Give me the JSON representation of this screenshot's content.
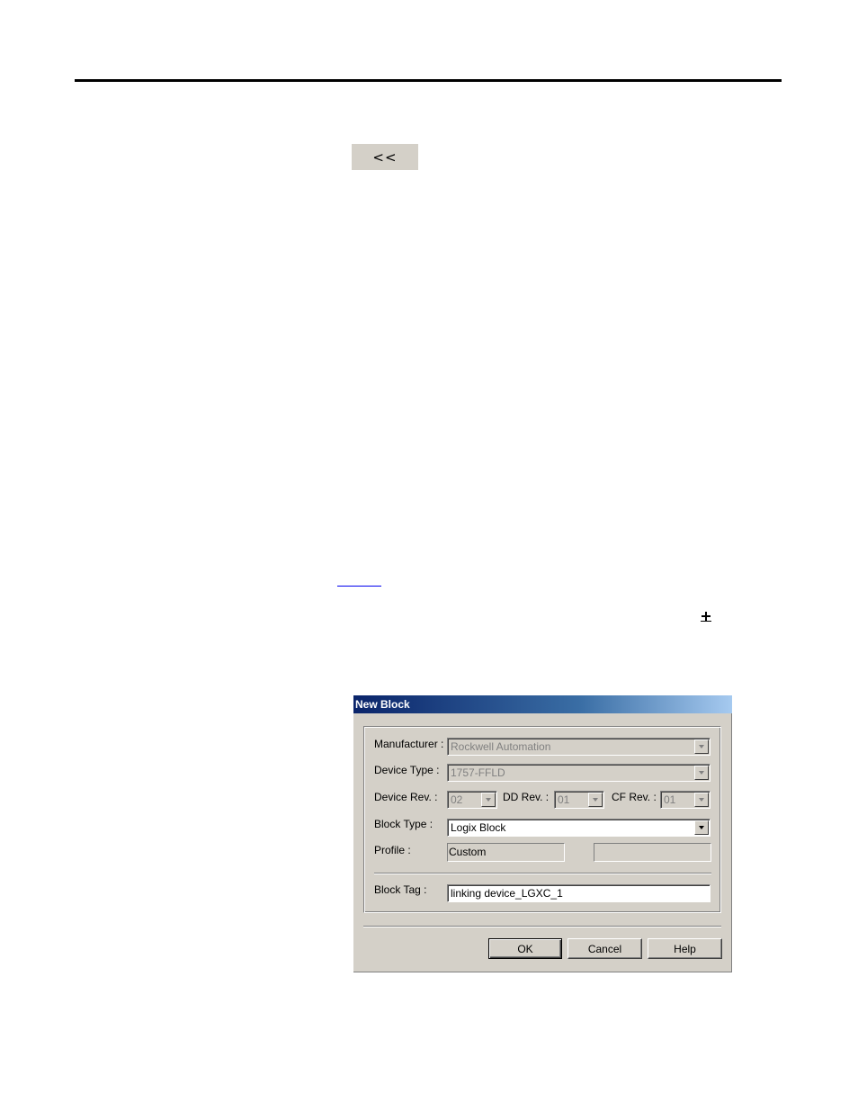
{
  "page": {
    "back_button_label": "<<"
  },
  "dialog": {
    "title": "New Block",
    "manufacturer": {
      "label": "Manufacturer :",
      "value": "Rockwell Automation"
    },
    "device_type": {
      "label": "Device Type :",
      "value": "1757-FFLD"
    },
    "device_rev": {
      "label": "Device Rev. :",
      "value": "02"
    },
    "dd_rev": {
      "label": "DD Rev. :",
      "value": "01"
    },
    "cf_rev": {
      "label": "CF Rev. :",
      "value": "01"
    },
    "block_type": {
      "label": "Block Type :",
      "value": "Logix Block"
    },
    "profile": {
      "label": "Profile :",
      "value": "Custom",
      "value2": ""
    },
    "block_tag": {
      "label": "Block Tag :",
      "value": "linking device_LGXC_1"
    },
    "buttons": {
      "ok": "OK",
      "cancel": "Cancel",
      "help": "Help"
    }
  },
  "colors": {
    "title_start": "#0a246a",
    "title_end": "#a6caf0",
    "face": "#d4d0c8"
  }
}
